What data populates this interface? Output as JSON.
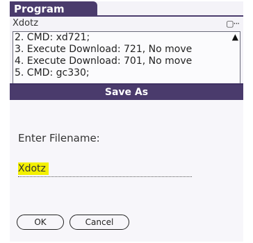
{
  "app": {
    "title": "Program",
    "doc_name": "Xdotz",
    "menu_icon": "menu-icon"
  },
  "list": {
    "items": [
      "2. CMD: xd721;",
      "3. Execute Download: 721, No move",
      "4. Execute Download: 701, No move",
      "5. CMD: gc330;"
    ],
    "scroll_icon": "scroll-up-arrow-icon"
  },
  "dialog": {
    "title": "Save As",
    "prompt_label": "Enter Filename:",
    "filename_value": "Xdotz",
    "ok_label": "OK",
    "cancel_label": "Cancel"
  },
  "colors": {
    "title_bar": "#4a3b6c",
    "highlight": "#f3f000"
  }
}
